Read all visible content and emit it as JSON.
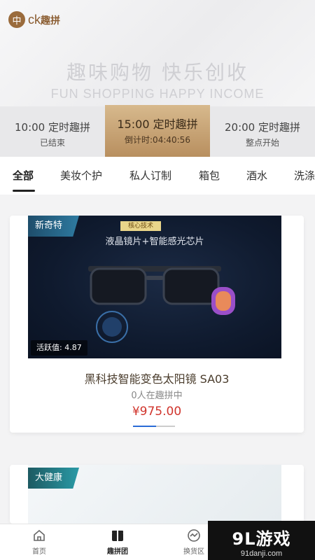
{
  "header": {
    "logo_text": "ck",
    "logo_suffix": "趣拼",
    "slogan_cn": "趣味购物  快乐创收",
    "slogan_en": "FUN SHOPPING    HAPPY INCOME"
  },
  "time_slots": [
    {
      "time": "10:00 定时趣拼",
      "status": "已结束"
    },
    {
      "time": "15:00 定时趣拼",
      "status": "倒计时:04:40:56"
    },
    {
      "time": "20:00 定时趣拼",
      "status": "整点开始"
    }
  ],
  "categories": [
    "全部",
    "美妆个护",
    "私人订制",
    "箱包",
    "酒水",
    "洗涤"
  ],
  "products": [
    {
      "tag": "新奇特",
      "badge": "核心技术",
      "headline": "液晶镜片+智能感光芯片",
      "activity": "活跃值: 4.87",
      "name": "黑科技智能变色太阳镜 SA03",
      "participants": "0人在趣拼中",
      "price": "¥975.00",
      "progress": 0.55
    },
    {
      "tag": "大健康"
    }
  ],
  "tabbar": [
    {
      "label": "首页",
      "icon": "home-icon"
    },
    {
      "label": "趣拼团",
      "icon": "gift-icon"
    },
    {
      "label": "换货区",
      "icon": "exchange-icon"
    }
  ],
  "watermark": {
    "main": "9L游戏",
    "sub": "91danji.com"
  },
  "colors": {
    "accent_gold": "#b88f5f",
    "price_red": "#d0342c",
    "progress_blue": "#2a6bd6"
  }
}
